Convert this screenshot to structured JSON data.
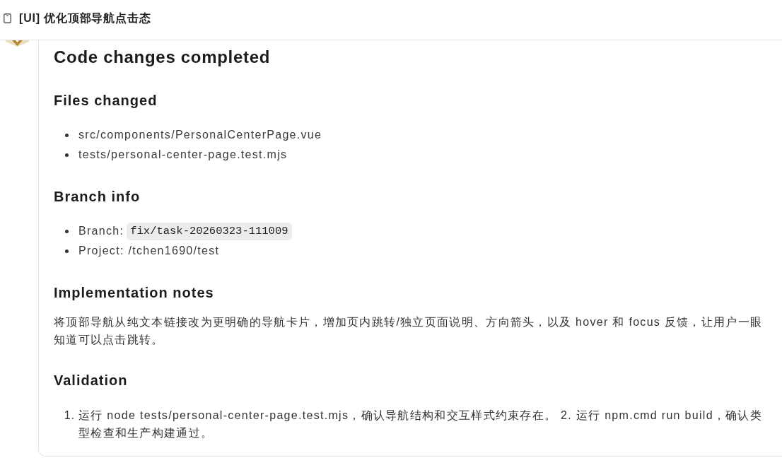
{
  "header": {
    "title": "[UI] 优化顶部导航点击态"
  },
  "message": {
    "title": "Code changes completed",
    "sections": [
      {
        "kind": "bullets",
        "heading": "Files changed",
        "items": [
          {
            "kind": "text",
            "text": "src/components/PersonalCenterPage.vue"
          },
          {
            "kind": "text",
            "text": "tests/personal-center-page.test.mjs"
          }
        ]
      },
      {
        "kind": "bullets",
        "heading": "Branch info",
        "items": [
          {
            "kind": "code",
            "label": "Branch:",
            "code": "fix/task-20260323-111009"
          },
          {
            "kind": "text",
            "text": "Project: /tchen1690/test"
          }
        ]
      },
      {
        "kind": "paragraph",
        "heading": "Implementation notes",
        "text": "将顶部导航从纯文本链接改为更明确的导航卡片，增加页内跳转/独立页面说明、方向箭头，以及 hover 和 focus 反馈，让用户一眼知道可以点击跳转。"
      },
      {
        "kind": "numbered",
        "heading": "Validation",
        "items": [
          {
            "number": "1.",
            "text": "运行 node tests/personal-center-page.test.mjs，确认导航结构和交互样式约束存在。 2. 运行 npm.cmd run build，确认类型检查和生产构建通过。"
          }
        ]
      }
    ]
  }
}
